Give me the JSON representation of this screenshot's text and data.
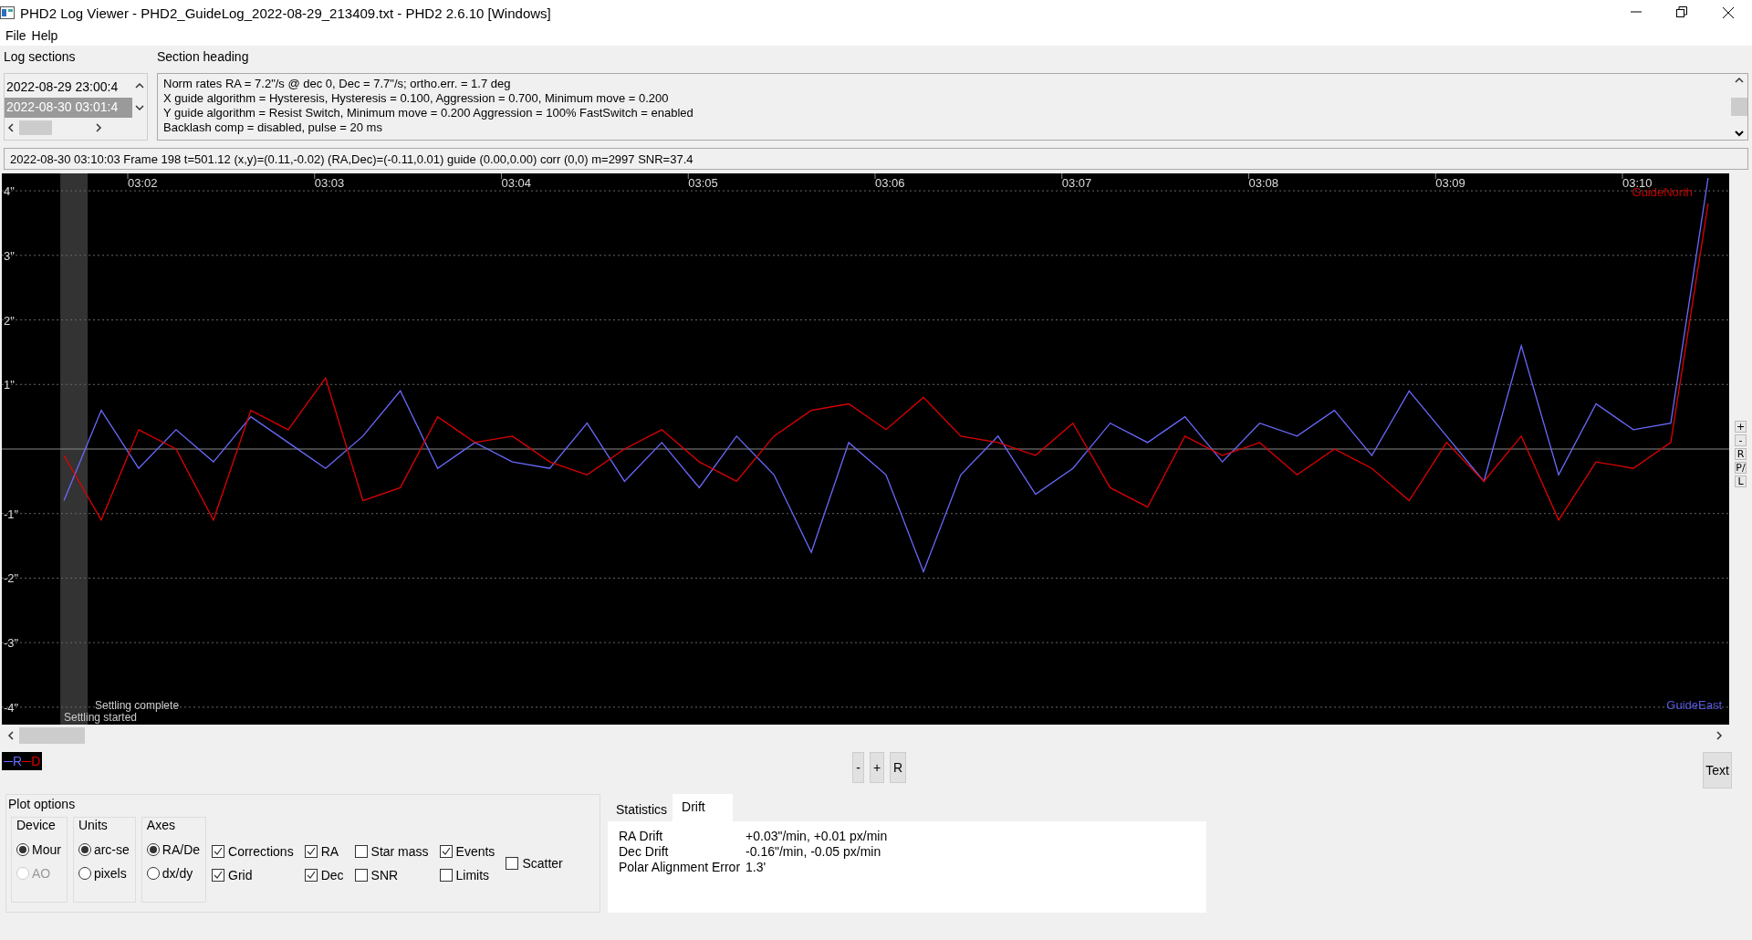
{
  "window": {
    "title": "PHD2 Log Viewer - PHD2_GuideLog_2022-08-29_213409.txt - PHD2 2.6.10 [Windows]"
  },
  "menu": [
    "File",
    "Help"
  ],
  "log_sections": {
    "label": "Log sections",
    "items": [
      {
        "text": "2022-08-29 23:00:4",
        "selected": false
      },
      {
        "text": "2022-08-30 03:01:4",
        "selected": true
      }
    ]
  },
  "section_heading": {
    "label": "Section heading",
    "lines": [
      "Norm rates RA = 7.2\"/s @ dec 0, Dec = 7.7\"/s; ortho.err. = 1.7 deg",
      "X guide algorithm = Hysteresis, Hysteresis = 0.100, Aggression = 0.700, Minimum move = 0.200",
      "Y guide algorithm = Resist Switch, Minimum move = 0.200 Aggression = 100% FastSwitch = enabled",
      "Backlash comp = disabled, pulse = 20 ms"
    ]
  },
  "status_line": "2022-08-30 03:10:03 Frame 198 t=501.12 (x,y)=(0.11,-0.02) (RA,Dec)=(-0.11,0.01) guide (0.00,0.00) corr (0,0) m=2997 SNR=37.4",
  "graph": {
    "chart_data": {
      "type": "line",
      "categories": [
        null,
        null,
        "03:02",
        null,
        null,
        null,
        null,
        "03:03",
        null,
        null,
        null,
        null,
        "03:04",
        null,
        null,
        null,
        null,
        "03:05",
        null,
        null,
        null,
        null,
        "03:06",
        null,
        null,
        null,
        null,
        "03:07",
        null,
        null,
        null,
        null,
        "03:08",
        null,
        null,
        null,
        null,
        "03:09",
        null,
        null,
        null,
        null,
        "03:10",
        null,
        null
      ],
      "series": [
        {
          "name": "R",
          "color": "#6a6aff",
          "values": [
            -0.8,
            0.6,
            -0.3,
            0.3,
            -0.2,
            0.5,
            0.1,
            -0.3,
            0.2,
            0.9,
            -0.3,
            0.1,
            -0.2,
            -0.3,
            0.4,
            -0.5,
            0.1,
            -0.6,
            0.2,
            -0.4,
            -1.6,
            0.1,
            -0.4,
            -1.9,
            -0.4,
            0.2,
            -0.7,
            -0.3,
            0.4,
            0.1,
            0.5,
            -0.2,
            0.4,
            0.2,
            0.6,
            -0.1,
            0.9,
            0.2,
            -0.5,
            1.6,
            -0.4,
            0.7,
            0.3,
            0.4,
            4.2
          ]
        },
        {
          "name": "D",
          "color": "#e00000",
          "values": [
            -0.1,
            -1.1,
            0.3,
            0.0,
            -1.1,
            0.6,
            0.3,
            1.1,
            -0.8,
            -0.6,
            0.5,
            0.1,
            0.2,
            -0.2,
            -0.4,
            0.0,
            0.3,
            -0.2,
            -0.5,
            0.2,
            0.6,
            0.7,
            0.3,
            0.8,
            0.2,
            0.1,
            -0.1,
            0.4,
            -0.6,
            -0.9,
            0.2,
            -0.1,
            0.1,
            -0.4,
            0.0,
            -0.3,
            -0.8,
            0.1,
            -0.5,
            0.2,
            -1.1,
            -0.2,
            -0.3,
            0.1,
            3.8
          ]
        }
      ],
      "grid": true,
      "ylim": [
        -4.27,
        4.27
      ],
      "yticks": [
        {
          "value": 4,
          "label": "4\""
        },
        {
          "value": 3,
          "label": "3\""
        },
        {
          "value": 2,
          "label": "2\""
        },
        {
          "value": 1,
          "label": "1\""
        },
        {
          "value": -1,
          "label": "-1\""
        },
        {
          "value": -2,
          "label": "-2\""
        },
        {
          "value": -3,
          "label": "-3\""
        },
        {
          "value": -4,
          "label": "-4\""
        }
      ]
    },
    "direction_labels": [
      {
        "text": "GuideNorth",
        "kind": "north"
      },
      {
        "text": "GuideEast",
        "kind": "east"
      }
    ],
    "events": [
      "Settling complete",
      "Settling started"
    ],
    "side_buttons": [
      "+",
      "-",
      "R",
      "P/",
      "L"
    ]
  },
  "zoom_buttons": [
    "-",
    "+",
    "R"
  ],
  "text_button": "Text",
  "plot_options": {
    "title": "Plot options",
    "groups": [
      {
        "title": "Device",
        "options": [
          {
            "label": "Mour",
            "selected": true,
            "disabled": false
          },
          {
            "label": "AO",
            "selected": false,
            "disabled": true
          }
        ]
      },
      {
        "title": "Units",
        "options": [
          {
            "label": "arc-se",
            "selected": true,
            "disabled": false
          },
          {
            "label": "pixels",
            "selected": false,
            "disabled": false
          }
        ]
      },
      {
        "title": "Axes",
        "options": [
          {
            "label": "RA/De",
            "selected": true,
            "disabled": false
          },
          {
            "label": "dx/dy",
            "selected": false,
            "disabled": false
          }
        ]
      }
    ],
    "checkbox_columns": [
      [
        {
          "label": "Corrections",
          "checked": true
        },
        {
          "label": "Grid",
          "checked": true
        }
      ],
      [
        {
          "label": "RA",
          "checked": true
        },
        {
          "label": "Dec",
          "checked": true
        }
      ],
      [
        {
          "label": "Star mass",
          "checked": false
        },
        {
          "label": "SNR",
          "checked": false
        }
      ],
      [
        {
          "label": "Events",
          "checked": true
        },
        {
          "label": "Limits",
          "checked": false
        }
      ],
      [
        {
          "label": "Scatter",
          "checked": false
        }
      ]
    ]
  },
  "tabs": [
    {
      "label": "Statistics",
      "selected": false
    },
    {
      "label": "Drift",
      "selected": true
    }
  ],
  "drift": [
    {
      "label": "RA Drift",
      "value": "+0.03\"/min, +0.01 px/min"
    },
    {
      "label": "Dec Drift",
      "value": "-0.16\"/min, -0.05 px/min"
    },
    {
      "label": "Polar Alignment Error",
      "value": "1.3'"
    }
  ]
}
